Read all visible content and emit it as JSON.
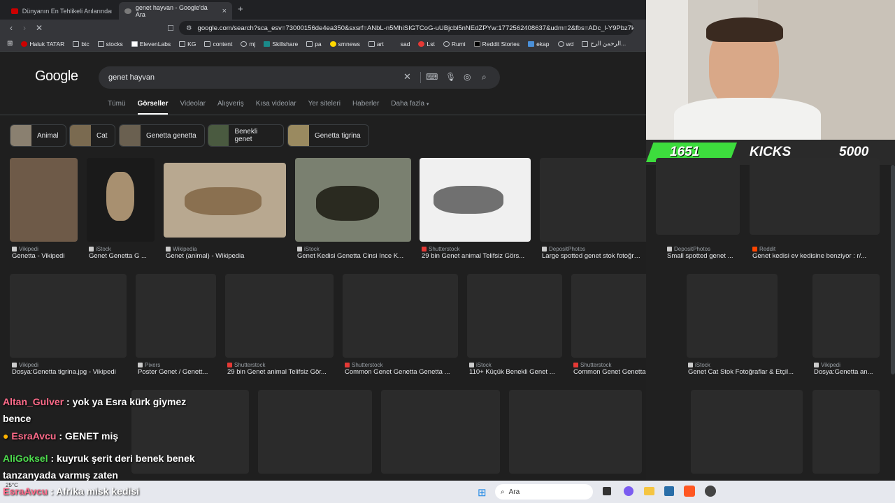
{
  "browser": {
    "tabs": [
      {
        "label": "Dünyanın En Tehlikeli Arılarından"
      },
      {
        "label": "genet hayvan - Google'da Ara"
      }
    ],
    "new_tab": "+",
    "url": "google.com/search?sca_esv=73000156de4ea350&sxsrf=ANbL-n5MhiSIGTCoG-uUBjcbl5nNEdZPYw:1772562408637&udm=2&fbs=ADc_l-Y9Pbz7kLb..."
  },
  "bookmarks": [
    "Haluk TATAR",
    "btc",
    "stocks",
    "ElevenLabs",
    "KG",
    "content",
    "mj",
    "Skillshare",
    "pa",
    "smnews",
    "art",
    "sad",
    "Lst",
    "Rumi",
    "Reddit Stories",
    "ekap",
    "wd",
    "الرحمن الرح..."
  ],
  "google": {
    "logo": "Google",
    "query": "genet hayvan",
    "nav_tabs": [
      "Tümü",
      "Görseller",
      "Videolar",
      "Alışveriş",
      "Kısa videolar",
      "Yer siteleri",
      "Haberler",
      "Daha fazla"
    ],
    "chips": [
      "Animal",
      "Cat",
      "Genetta genetta",
      "Benekli genet",
      "Genetta tigrina"
    ],
    "row1": [
      {
        "source": "Vikipedi",
        "caption": "Genetta - Vikipedi"
      },
      {
        "source": "iStock",
        "caption": "Genet Genetta G ..."
      },
      {
        "source": "Wikipedia",
        "caption": "Genet (animal) - Wikipedia"
      },
      {
        "source": "iStock",
        "caption": "Genet Kedisi Genetta Cinsi Ince K..."
      },
      {
        "source": "Shutterstock",
        "caption": "29 bin Genet animal Telifsiz Görs..."
      },
      {
        "source": "DepositPhotos",
        "caption": "Large spotted genet stok fotoğrafla..."
      },
      {
        "source": "DepositPhotos",
        "caption": "Small spotted genet ..."
      },
      {
        "source": "Reddit",
        "caption": "Genet kedisi ev kedisine benziyor : r/..."
      }
    ],
    "row2": [
      {
        "source": "Vikipedi",
        "caption": "Dosya:Genetta tigrina.jpg - Vikipedi"
      },
      {
        "source": "Pixers",
        "caption": "Poster Genet / Genett..."
      },
      {
        "source": "Shutterstock",
        "caption": "29 bin Genet animal Telifsiz Gör..."
      },
      {
        "source": "Shutterstock",
        "caption": "Common Genet Genetta Genetta ..."
      },
      {
        "source": "iStock",
        "caption": "110+ Küçük Benekli Genet ..."
      },
      {
        "source": "Shutterstock",
        "caption": "Common Genet Genetta Genett..."
      },
      {
        "source": "iStock",
        "caption": "Genet Cat Stok Fotoğraflar & Etçil..."
      },
      {
        "source": "Vikipedi",
        "caption": "Dosya:Genetta an..."
      }
    ]
  },
  "overlay": {
    "kicks_count": "1651",
    "kicks_label": "KICKS",
    "kicks_goal": "5000"
  },
  "chat": [
    {
      "user": "Altan_Gulver",
      "user_color": "#ff6b8a",
      "text": ": yok ya Esra kürk giymez bence"
    },
    {
      "user": "EsraAvcu",
      "user_color": "#ff6b8a",
      "text": ": GENET miş"
    },
    {
      "user": "AliGoksel",
      "user_color": "#4ddb4d",
      "text": ": kuyruk şerit deri benek benek tanzanyada varmış zaten"
    },
    {
      "user": "EsraAvcu",
      "user_color": "#ff6b8a",
      "text": ": Afrika misk kedisi"
    }
  ],
  "taskbar": {
    "search": "Ara",
    "weather": "25°C"
  }
}
